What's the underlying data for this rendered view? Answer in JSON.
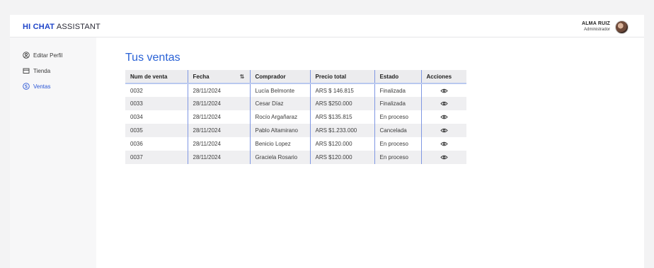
{
  "header": {
    "brand_bold": "HI CHAT",
    "brand_rest": " ASSISTANT",
    "user_name": "ALMA RUIZ",
    "user_role": "Administrador"
  },
  "sidebar": {
    "items": [
      {
        "label": "Editar Perfil",
        "icon": "user-circle-icon",
        "active": false
      },
      {
        "label": "Tienda",
        "icon": "store-icon",
        "active": false
      },
      {
        "label": "Ventas",
        "icon": "dollar-circle-icon",
        "active": true
      }
    ]
  },
  "main": {
    "title": "Tus ventas",
    "columns": [
      "Num de venta",
      "Fecha",
      "Comprador",
      "Precio total",
      "Estado",
      "Acciones"
    ],
    "rows": [
      {
        "num": "0032",
        "fecha": "28/11/2024",
        "comprador": "Lucía Belmonte",
        "precio": "ARS $ 146.815",
        "estado": "Finalizada"
      },
      {
        "num": "0033",
        "fecha": "28/11/2024",
        "comprador": "Cesar Díaz",
        "precio": "ARS $250.000",
        "estado": "Finalizada"
      },
      {
        "num": "0034",
        "fecha": "28/11/2024",
        "comprador": "Rocío Argañaraz",
        "precio": "ARS $135.815",
        "estado": "En proceso"
      },
      {
        "num": "0035",
        "fecha": "28/11/2024",
        "comprador": "Pablo Altamirano",
        "precio": "ARS $1.233.000",
        "estado": "Cancelada"
      },
      {
        "num": "0036",
        "fecha": "28/11/2024",
        "comprador": "Benicio Lopez",
        "precio": "ARS $120.000",
        "estado": "En proceso"
      },
      {
        "num": "0037",
        "fecha": "28/11/2024",
        "comprador": "Graciela Rosario",
        "precio": "ARS $120.000",
        "estado": "En proceso"
      }
    ]
  },
  "colors": {
    "accent": "#2a62d6",
    "brand": "#1f45c9",
    "finalizada": "#1f8a4a",
    "en_proceso": "#f08a1e",
    "cancelada": "#e0453a"
  }
}
